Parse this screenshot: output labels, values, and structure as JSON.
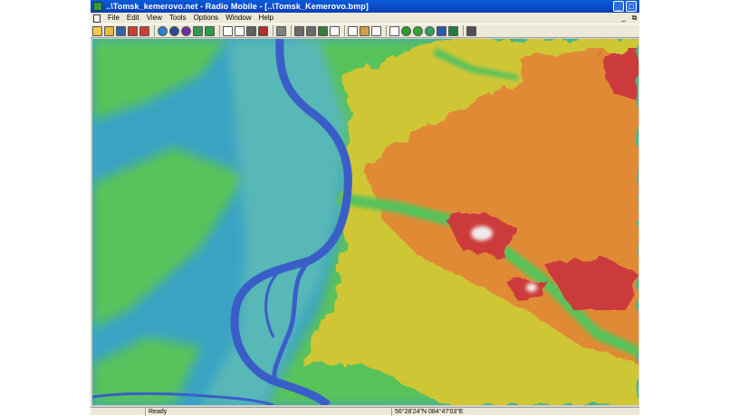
{
  "window": {
    "title": "..\\Tomsk_kemerovo.net - Radio Mobile - [..\\Tomsk_Kemerovo.bmp]",
    "minimize_glyph": "_",
    "maximize_glyph": "□"
  },
  "menu": {
    "items": [
      "File",
      "Edit",
      "View",
      "Tools",
      "Options",
      "Window",
      "Help"
    ],
    "mdi_minimize_glyph": "_",
    "mdi_restore_glyph": "⧉"
  },
  "toolbar": {
    "groups": [
      [
        {
          "name": "open-network-icon",
          "color": "#f2c94c"
        },
        {
          "name": "open-folder-icon",
          "color": "#e8b840"
        },
        {
          "name": "save-icon",
          "color": "#3b5fa8"
        },
        {
          "name": "network-properties-icon",
          "color": "#c84030"
        },
        {
          "name": "tools-icon",
          "color": "#c84030"
        }
      ],
      [
        {
          "name": "world-map-icon",
          "color": "#2f7fd0",
          "round": true
        },
        {
          "name": "zoom-icon",
          "color": "#2a4a90",
          "round": true
        },
        {
          "name": "radio-link-icon",
          "color": "#7030a0",
          "round": true
        },
        {
          "name": "arrow-left-icon",
          "color": "#2e9a4a"
        },
        {
          "name": "arrow-right-icon",
          "color": "#2e9a4a"
        }
      ],
      [
        {
          "name": "window-icon",
          "color": "#ffffff"
        },
        {
          "name": "window-alt-icon",
          "color": "#ffffff"
        },
        {
          "name": "picture-icon",
          "color": "#606060"
        },
        {
          "name": "picture-edit-icon",
          "color": "#b03030"
        }
      ],
      [
        {
          "name": "print-icon",
          "color": "#808080"
        }
      ],
      [
        {
          "name": "copy-icon",
          "color": "#6a6a6a"
        },
        {
          "name": "paste-icon",
          "color": "#6a6a6a"
        },
        {
          "name": "elevation-icon",
          "color": "#3a7a3a"
        },
        {
          "name": "crosshair-icon",
          "color": "#ffffff"
        }
      ],
      [
        {
          "name": "frame-icon",
          "color": "#ffffff"
        },
        {
          "name": "user-icon",
          "color": "#d0a040"
        },
        {
          "name": "fit-icon",
          "color": "#ffffff"
        }
      ],
      [
        {
          "name": "antenna-icon",
          "color": "#ffffff"
        },
        {
          "name": "coverage-icon",
          "color": "#2a9a2a",
          "round": true
        },
        {
          "name": "polar-icon",
          "color": "#3aa03a",
          "round": true
        },
        {
          "name": "combined-icon",
          "color": "#30a060",
          "round": true
        },
        {
          "name": "radio-icon",
          "color": "#2a5ab0"
        },
        {
          "name": "map-overlay-icon",
          "color": "#208040"
        }
      ],
      [
        {
          "name": "exit-icon",
          "color": "#505050"
        }
      ]
    ]
  },
  "map": {
    "colors": {
      "lowland": "#3aa3c4",
      "river": "#3a5ec8",
      "floodplain": "#58b7b7",
      "plain": "#58c25a",
      "slope": "#cfc636",
      "high": "#e08a34",
      "peak": "#cc3b3b",
      "snow": "#f2eaea"
    }
  },
  "status": {
    "ready": "Ready",
    "coordinates": "56°28'24\"N 084°47'03\"E"
  }
}
